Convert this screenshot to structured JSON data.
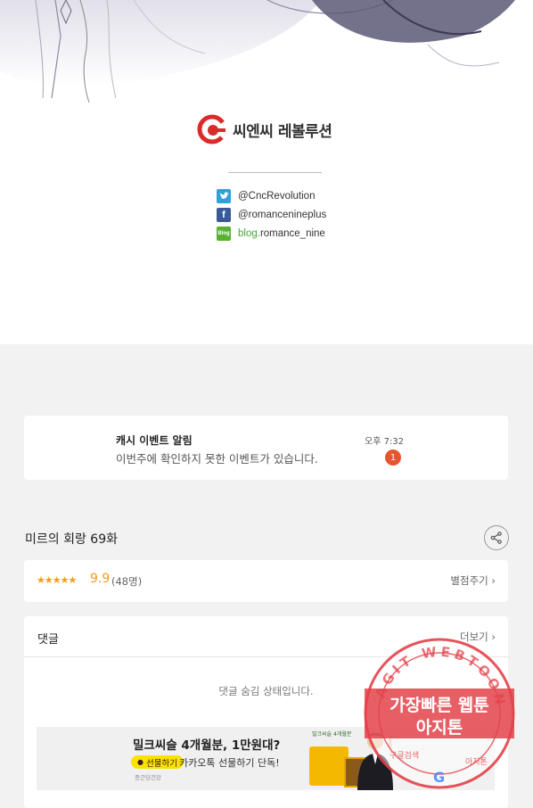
{
  "credits": {
    "publisher_name": "씨엔씨 레볼루션",
    "twitter": "@CncRevolution",
    "facebook": "@romancenineplus",
    "blog_prefix": "blog.",
    "blog_handle": "romance_nine",
    "blog_icon_text": "Blog"
  },
  "event": {
    "title": "캐시 이벤트 알림",
    "message": "이번주에 확인하지 못한 이벤트가 있습니다.",
    "time": "오후 7:32",
    "badge_count": "1"
  },
  "episode": {
    "title": "미르의 회랑 69화",
    "share_icon": "share-icon"
  },
  "rating": {
    "stars": "★★★★★",
    "score": "9.9",
    "voters": "(48명)",
    "rate_label": "별점주기"
  },
  "comments": {
    "title": "댓글",
    "more_label": "더보기",
    "hidden_message": "댓글 숨김 상태입니다."
  },
  "ad": {
    "headline": "밀크씨슬 4개월분, 1만원대?",
    "gift_button": "선물하기",
    "gift_desc": "카카오톡 선물하기 단독!",
    "brand": "종근당건강",
    "product_label": "밀크씨슬 4개월분",
    "accent_color": "#fae100"
  },
  "watermark": {
    "line1": "가장빠른 웹툰",
    "line2": "아지톤",
    "ring_text": "AGIT WEBTOON",
    "bottom_left": "구글검색",
    "bottom_right": "아지톤"
  },
  "colors": {
    "rating": "#f29a1f",
    "badge": "#e4572e",
    "twitter": "#2ea1da",
    "facebook": "#3b5a9a",
    "blog": "#57b233",
    "stamp": "#e3424a"
  }
}
